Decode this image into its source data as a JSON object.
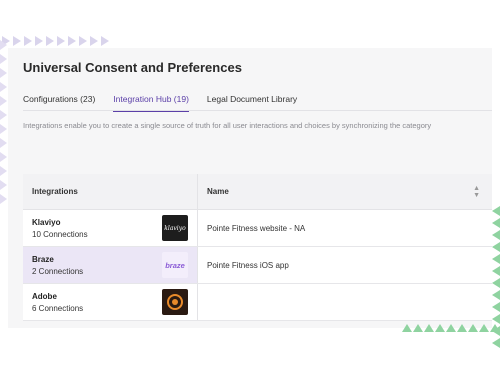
{
  "page_title": "Universal Consent and Preferences",
  "tabs": [
    {
      "label": "Configurations (23)",
      "active": false
    },
    {
      "label": "Integration Hub (19)",
      "active": true
    },
    {
      "label": "Legal Document Library",
      "active": false
    }
  ],
  "description": "Integrations enable you to create a single source of truth for all user interactions and choices by synchronizing the category",
  "table": {
    "col1_header": "Integrations",
    "col2_header": "Name",
    "sort_icon": "sort-icon",
    "rows": [
      {
        "name": "Klaviyo",
        "count": "10 Connections",
        "logo_text": "klaviyo",
        "detail": "Pointe Fitness website - NA",
        "selected": false
      },
      {
        "name": "Braze",
        "count": "2 Connections",
        "logo_text": "braze",
        "detail": "Pointe Fitness iOS app",
        "selected": true
      },
      {
        "name": "Adobe",
        "count": "6 Connections",
        "logo_text": "",
        "detail": "",
        "selected": false
      }
    ]
  },
  "colors": {
    "accent": "#5b3fa8",
    "selected_row": "#ebe6f6",
    "decor_purple": "#d9d4ec",
    "decor_green": "#8fd3a0"
  }
}
